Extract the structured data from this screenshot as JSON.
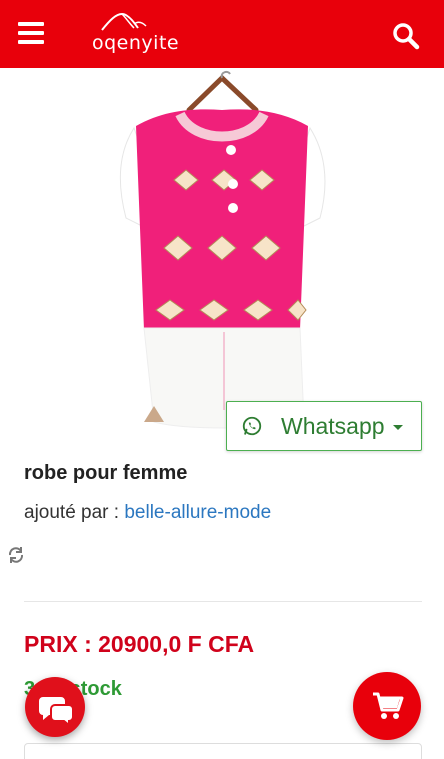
{
  "header": {
    "menu_icon": "hamburger-menu-icon",
    "logo_text": "oqenyite",
    "search_icon": "search-icon",
    "bg_color": "#e8000b"
  },
  "product": {
    "image_alt": "robe pour femme",
    "title": "robe pour femme",
    "added_by_label": "ajouté par :",
    "seller": "belle-allure-mode",
    "price": "PRIX : 20900,0 F CFA",
    "stock": "3 en stock"
  },
  "whatsapp": {
    "label": "Whatsapp",
    "icon": "whatsapp-icon",
    "color": "#2e7d32"
  },
  "actions": {
    "refresh_icon": "refresh-icon",
    "chat_icon": "chat-bubbles-icon",
    "cart_icon": "shopping-cart-icon"
  }
}
